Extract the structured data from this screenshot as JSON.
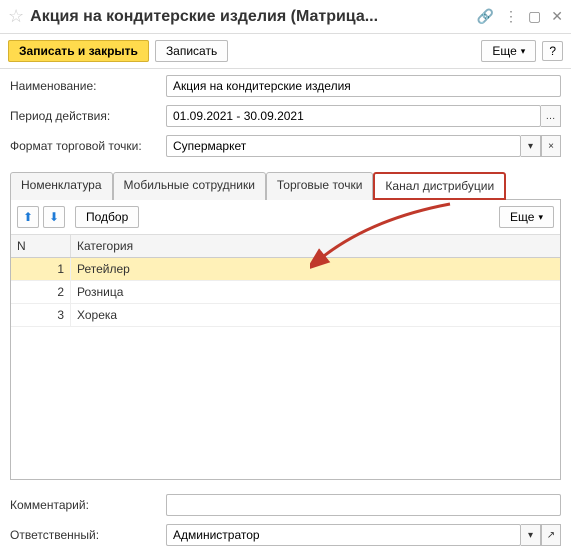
{
  "titlebar": {
    "title": "Акция на кондитерские изделия (Матрица..."
  },
  "toolbar": {
    "save_close": "Записать и закрыть",
    "save": "Записать",
    "more": "Еще",
    "help": "?"
  },
  "form": {
    "name_label": "Наименование:",
    "name_value": "Акция на кондитерские изделия",
    "period_label": "Период действия:",
    "period_value": "01.09.2021 - 30.09.2021",
    "format_label": "Формат торговой точки:",
    "format_value": "Супермаркет"
  },
  "tabs": {
    "nomenclature": "Номенклатура",
    "mobile": "Мобильные сотрудники",
    "points": "Торговые точки",
    "channel": "Канал дистрибуции"
  },
  "tab_toolbar": {
    "select": "Подбор",
    "more": "Еще"
  },
  "table": {
    "col_n": "N",
    "col_cat": "Категория",
    "rows": [
      {
        "n": "1",
        "cat": "Ретейлер"
      },
      {
        "n": "2",
        "cat": "Розница"
      },
      {
        "n": "3",
        "cat": "Хорека"
      }
    ]
  },
  "footer": {
    "comment_label": "Комментарий:",
    "comment_value": "",
    "resp_label": "Ответственный:",
    "resp_value": "Администратор"
  }
}
